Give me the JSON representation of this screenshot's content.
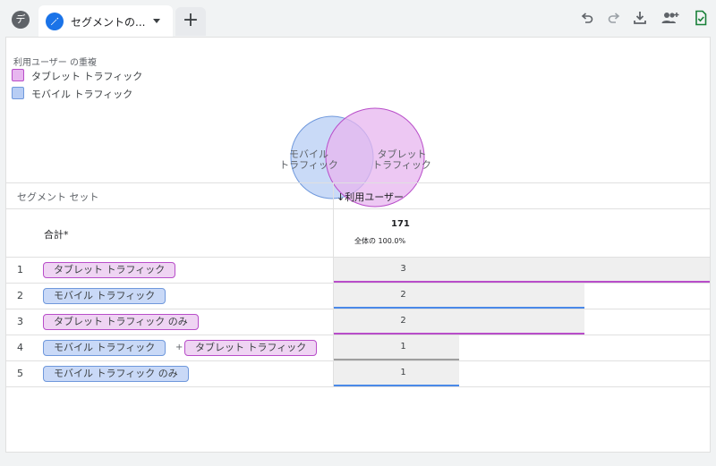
{
  "topbar": {
    "avatar_letter": "デ",
    "tab_label": "セグメントの...",
    "add_tab_label": "+"
  },
  "icons": {
    "undo": "undo-icon",
    "redo": "redo-icon",
    "download": "download-icon",
    "share": "add-people-icon",
    "save": "save-check-icon"
  },
  "venn": {
    "title": "利用ユーザー の重複",
    "legend": [
      {
        "label": "タブレット トラフィック",
        "color": "#e7b6ef",
        "border": "#b84dc9"
      },
      {
        "label": "モバイル トラフィック",
        "color": "#b7cdf4",
        "border": "#6f98dc"
      }
    ],
    "left_circle_label_1": "モバイル",
    "left_circle_label_2": "トラフィック",
    "right_circle_label_1": "タブレット",
    "right_circle_label_2": "トラフィック"
  },
  "table": {
    "col_segment": "セグメント セット",
    "col_users": "↓利用ユーザー",
    "total_label": "合計*",
    "total_value": "171",
    "total_sub": "全体の 100.0%",
    "rows": [
      {
        "num": "1",
        "chips": [
          "タブレット トラフィック"
        ],
        "value": "3",
        "fraction": 1.0,
        "line_color": "#b84dc9"
      },
      {
        "num": "2",
        "chips": [
          "モバイル トラフィック"
        ],
        "value": "2",
        "fraction": 0.667,
        "line_color": "#4a89e8"
      },
      {
        "num": "3",
        "chips": [
          "タブレット トラフィック のみ"
        ],
        "value": "2",
        "fraction": 0.667,
        "line_color": "#b84dc9"
      },
      {
        "num": "4",
        "chips": [
          "モバイル トラフィック",
          "タブレット トラフィック"
        ],
        "plus": "+",
        "value": "1",
        "fraction": 0.333,
        "line_color": "#9e9e9e"
      },
      {
        "num": "5",
        "chips": [
          "モバイル トラフィック のみ"
        ],
        "value": "1",
        "fraction": 0.333,
        "line_color": "#4a89e8"
      }
    ]
  }
}
